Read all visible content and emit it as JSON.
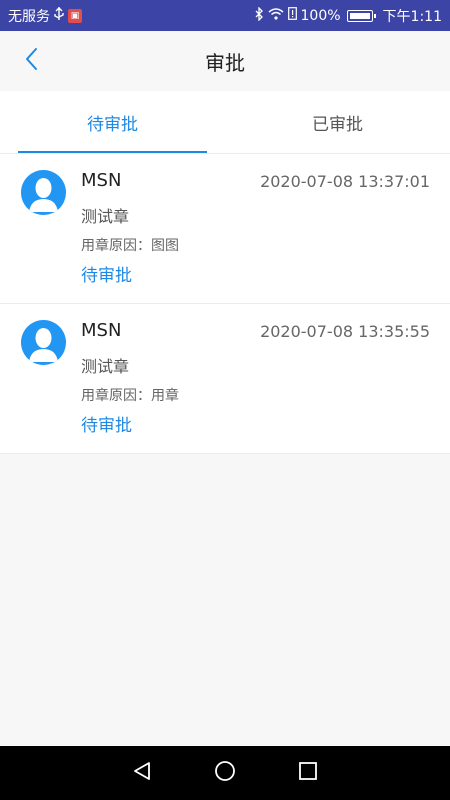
{
  "status_bar": {
    "carrier": "无服务",
    "battery": "100%",
    "time": "下午1:11"
  },
  "header": {
    "title": "审批"
  },
  "tabs": [
    {
      "label": "待审批",
      "active": true
    },
    {
      "label": "已审批",
      "active": false
    }
  ],
  "items": [
    {
      "name": "MSN",
      "time": "2020-07-08 13:37:01",
      "seal": "测试章",
      "reason": "用章原因：图图",
      "status": "待审批"
    },
    {
      "name": "MSN",
      "time": "2020-07-08 13:35:55",
      "seal": "测试章",
      "reason": "用章原因：用章",
      "status": "待审批"
    }
  ],
  "colors": {
    "status_bar": "#3c44a5",
    "accent": "#1e88e5",
    "avatar": "#2196f3"
  },
  "icons": [
    "usb-icon",
    "sim-icon",
    "bluetooth-icon",
    "wifi-icon",
    "alert-icon",
    "battery-icon",
    "back-arrow-icon",
    "avatar-icon",
    "nav-back-icon",
    "nav-home-icon",
    "nav-recents-icon"
  ]
}
